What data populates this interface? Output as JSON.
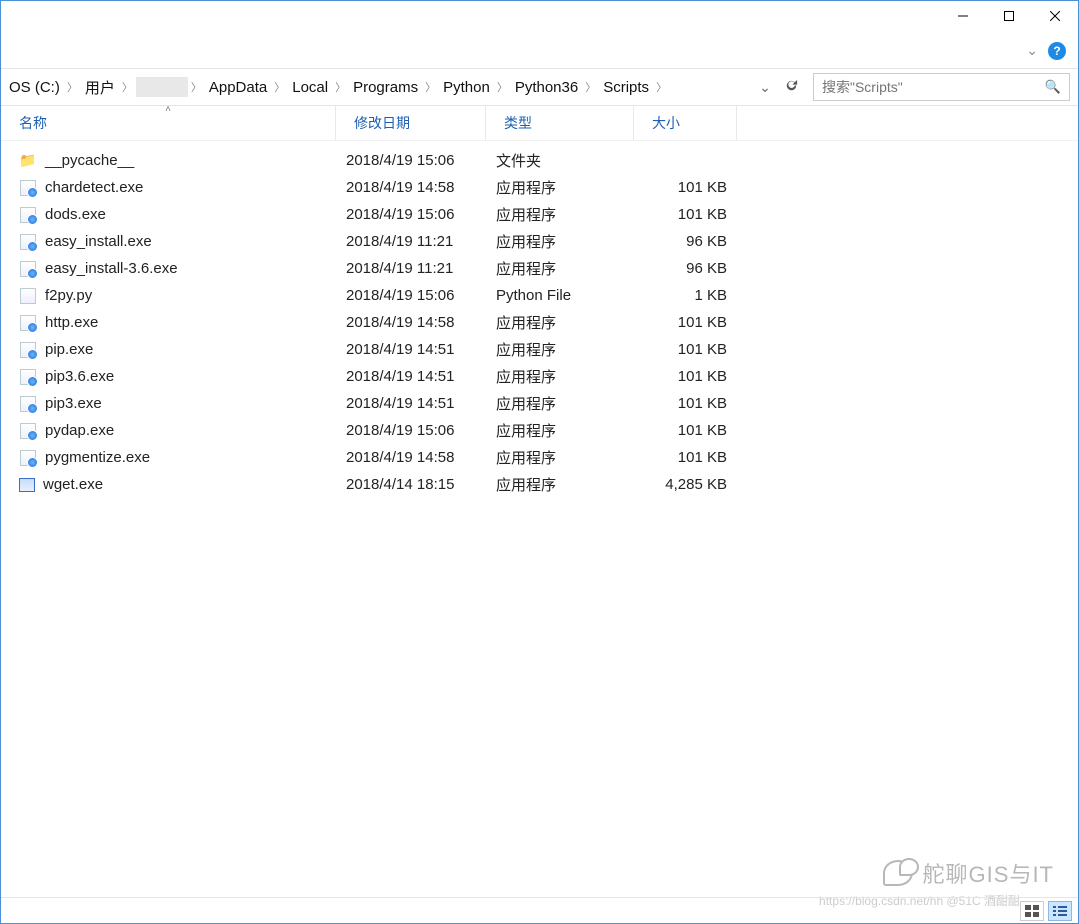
{
  "titlebar": {
    "min_icon": "minimize-icon",
    "max_icon": "maximize-icon",
    "close_icon": "close-icon"
  },
  "help": {
    "glyph": "?"
  },
  "breadcrumbs": [
    "OS (C:)",
    "用户",
    "",
    "AppData",
    "Local",
    "Programs",
    "Python",
    "Python36",
    "Scripts"
  ],
  "search": {
    "placeholder": "搜索\"Scripts\""
  },
  "columns": {
    "name": "名称",
    "date": "修改日期",
    "type": "类型",
    "size": "大小"
  },
  "files": [
    {
      "name": "__pycache__",
      "date": "2018/4/19 15:06",
      "type": "文件夹",
      "size": "",
      "icon": "folder"
    },
    {
      "name": "chardetect.exe",
      "date": "2018/4/19 14:58",
      "type": "应用程序",
      "size": "101 KB",
      "icon": "exe"
    },
    {
      "name": "dods.exe",
      "date": "2018/4/19 15:06",
      "type": "应用程序",
      "size": "101 KB",
      "icon": "exe"
    },
    {
      "name": "easy_install.exe",
      "date": "2018/4/19 11:21",
      "type": "应用程序",
      "size": "96 KB",
      "icon": "exe"
    },
    {
      "name": "easy_install-3.6.exe",
      "date": "2018/4/19 11:21",
      "type": "应用程序",
      "size": "96 KB",
      "icon": "exe"
    },
    {
      "name": "f2py.py",
      "date": "2018/4/19 15:06",
      "type": "Python File",
      "size": "1 KB",
      "icon": "py"
    },
    {
      "name": "http.exe",
      "date": "2018/4/19 14:58",
      "type": "应用程序",
      "size": "101 KB",
      "icon": "exe"
    },
    {
      "name": "pip.exe",
      "date": "2018/4/19 14:51",
      "type": "应用程序",
      "size": "101 KB",
      "icon": "exe"
    },
    {
      "name": "pip3.6.exe",
      "date": "2018/4/19 14:51",
      "type": "应用程序",
      "size": "101 KB",
      "icon": "exe"
    },
    {
      "name": "pip3.exe",
      "date": "2018/4/19 14:51",
      "type": "应用程序",
      "size": "101 KB",
      "icon": "exe"
    },
    {
      "name": "pydap.exe",
      "date": "2018/4/19 15:06",
      "type": "应用程序",
      "size": "101 KB",
      "icon": "exe"
    },
    {
      "name": "pygmentize.exe",
      "date": "2018/4/19 14:58",
      "type": "应用程序",
      "size": "101 KB",
      "icon": "exe"
    },
    {
      "name": "wget.exe",
      "date": "2018/4/14 18:15",
      "type": "应用程序",
      "size": "4,285 KB",
      "icon": "wget"
    }
  ],
  "watermark": {
    "text": "舵聊GIS与IT",
    "sub": "https://blog.csdn.net/hh @51C 酒酣酣"
  }
}
